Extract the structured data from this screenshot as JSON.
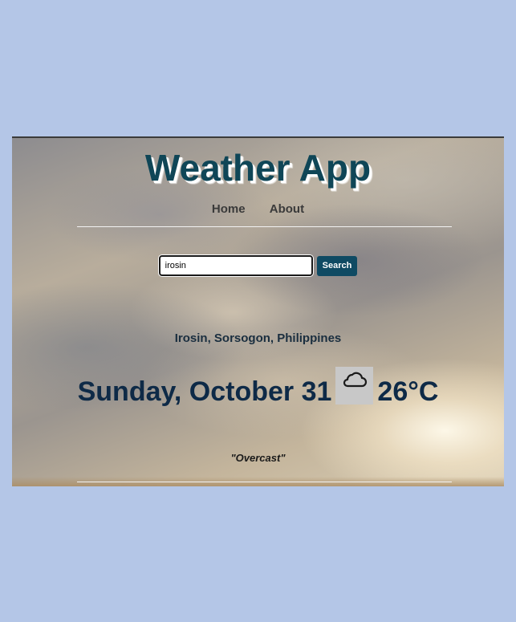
{
  "app": {
    "title": "Weather App"
  },
  "nav": {
    "items": [
      {
        "label": "Home"
      },
      {
        "label": "About"
      }
    ]
  },
  "search": {
    "value": "irosin",
    "button_label": "Search"
  },
  "weather": {
    "location": "Irosin, Sorsogon, Philippines",
    "date": "Sunday, October 31",
    "icon": "cloud-icon",
    "temperature": "26°C",
    "condition": "\"Overcast\""
  },
  "colors": {
    "page_background": "#b4c6e7",
    "title": "#0f4657",
    "button": "#0f4a63",
    "weather_text": "#0e2a47"
  }
}
